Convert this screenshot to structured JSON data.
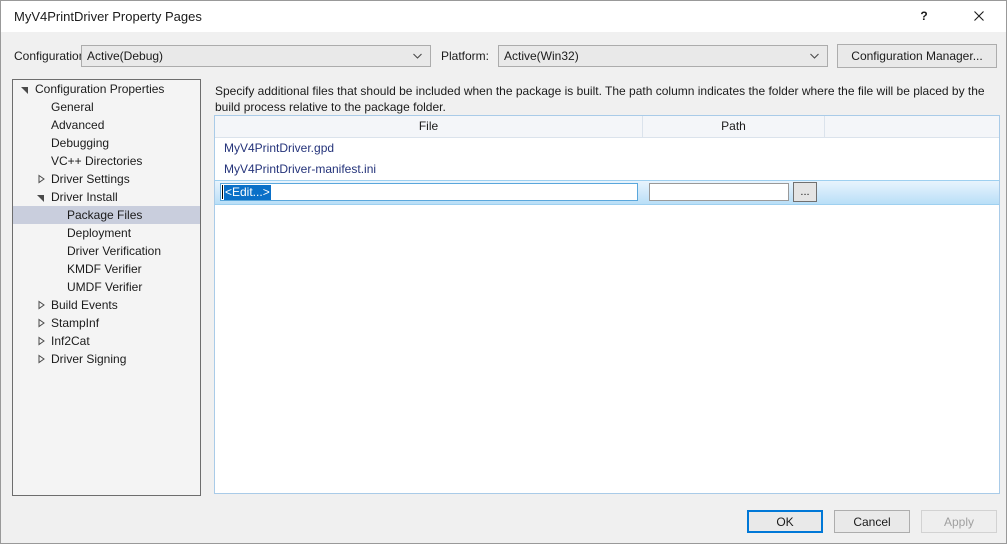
{
  "window": {
    "title": "MyV4PrintDriver Property Pages",
    "help_icon": "question-mark-icon",
    "close_icon": "close-icon"
  },
  "config_bar": {
    "configuration_label": "Configuration:",
    "configuration_value": "Active(Debug)",
    "platform_label": "Platform:",
    "platform_value": "Active(Win32)",
    "configuration_manager_label": "Configuration Manager...",
    "caret_glyph": "⌄"
  },
  "tree": {
    "items": [
      {
        "label": "Configuration Properties",
        "level": 0,
        "twisty": "expanded",
        "selected": false
      },
      {
        "label": "General",
        "level": 1,
        "twisty": "none",
        "selected": false
      },
      {
        "label": "Advanced",
        "level": 1,
        "twisty": "none",
        "selected": false
      },
      {
        "label": "Debugging",
        "level": 1,
        "twisty": "none",
        "selected": false
      },
      {
        "label": "VC++ Directories",
        "level": 1,
        "twisty": "none",
        "selected": false
      },
      {
        "label": "Driver Settings",
        "level": 1,
        "twisty": "collapsed",
        "selected": false
      },
      {
        "label": "Driver Install",
        "level": 1,
        "twisty": "expanded",
        "selected": false
      },
      {
        "label": "Package Files",
        "level": 2,
        "twisty": "none",
        "selected": true
      },
      {
        "label": "Deployment",
        "level": 2,
        "twisty": "none",
        "selected": false
      },
      {
        "label": "Driver Verification",
        "level": 2,
        "twisty": "none",
        "selected": false
      },
      {
        "label": "KMDF Verifier",
        "level": 2,
        "twisty": "none",
        "selected": false
      },
      {
        "label": "UMDF Verifier",
        "level": 2,
        "twisty": "none",
        "selected": false
      },
      {
        "label": "Build Events",
        "level": 1,
        "twisty": "collapsed",
        "selected": false
      },
      {
        "label": "StampInf",
        "level": 1,
        "twisty": "collapsed",
        "selected": false
      },
      {
        "label": "Inf2Cat",
        "level": 1,
        "twisty": "collapsed",
        "selected": false
      },
      {
        "label": "Driver Signing",
        "level": 1,
        "twisty": "collapsed",
        "selected": false
      }
    ]
  },
  "main": {
    "description": "Specify additional files that should be included when the package is built.  The path column indicates the folder where the file will be placed by the build process relative to the package folder.",
    "grid": {
      "columns": [
        "File",
        "Path",
        ""
      ],
      "rows": [
        {
          "file": "MyV4PrintDriver.gpd",
          "path": ""
        },
        {
          "file": "MyV4PrintDriver-manifest.ini",
          "path": ""
        }
      ],
      "edit_row": {
        "file_value": "<Edit...>",
        "file_value_selected": true,
        "path_value": "",
        "browse_label": "...",
        "browse_icon": "ellipsis-icon"
      }
    }
  },
  "footer": {
    "ok_label": "OK",
    "cancel_label": "Cancel",
    "apply_label": "Apply",
    "apply_disabled": true
  },
  "colors": {
    "accent": "#0078d7",
    "selection_blue": "#0a70c8",
    "tree_selection": "#c9cedd",
    "link_text": "#24337a",
    "grid_border": "#a9cbe8"
  }
}
